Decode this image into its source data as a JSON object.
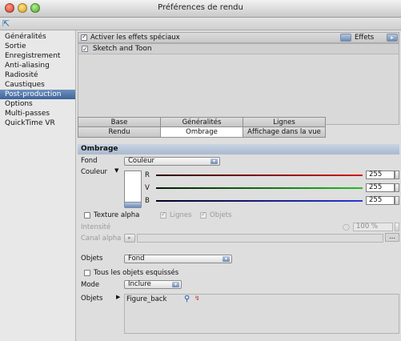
{
  "window": {
    "title": "Préférences de rendu"
  },
  "sidebar": {
    "items": [
      {
        "label": "Généralités"
      },
      {
        "label": "Sortie"
      },
      {
        "label": "Enregistrement"
      },
      {
        "label": "Anti-aliasing"
      },
      {
        "label": "Radiosité"
      },
      {
        "label": "Caustiques"
      },
      {
        "label": "Post-production",
        "selected": true
      },
      {
        "label": "Options"
      },
      {
        "label": "Multi-passes"
      },
      {
        "label": "QuickTime VR"
      }
    ]
  },
  "effects_bar": {
    "enable_label": "Activer les effets spéciaux",
    "enable_checked": true,
    "effects_menu_label": "Effets"
  },
  "effects_list": {
    "items": [
      {
        "label": "Sketch and Toon",
        "checked": true
      }
    ]
  },
  "tabs": {
    "row1": [
      "Base",
      "Généralités",
      "Lignes"
    ],
    "row2": [
      "Rendu",
      "Ombrage",
      "Affichage dans la vue"
    ],
    "active": "Ombrage"
  },
  "section": {
    "title": "Ombrage"
  },
  "fond": {
    "label": "Fond",
    "value": "Couleur"
  },
  "couleur": {
    "label": "Couleur",
    "channels": [
      {
        "name": "R",
        "value": "255",
        "color": "#c81e1e"
      },
      {
        "name": "V",
        "value": "255",
        "color": "#1db51d"
      },
      {
        "name": "B",
        "value": "255",
        "color": "#2a37c9"
      }
    ]
  },
  "texture_alpha": {
    "label": "Texture alpha",
    "lignes_label": "Lignes",
    "objets_label": "Objets",
    "intensity_label": "Intensité",
    "intensity_value": "100 %",
    "canal_alpha_label": "Canal alpha",
    "browse_label": "..."
  },
  "objets": {
    "label": "Objets",
    "value": "Fond",
    "tous_label": "Tous les objets esquissés",
    "mode_label": "Mode",
    "mode_value": "Inclure",
    "list_label": "Objets",
    "list_items": [
      {
        "name": "Figure_back"
      }
    ]
  }
}
